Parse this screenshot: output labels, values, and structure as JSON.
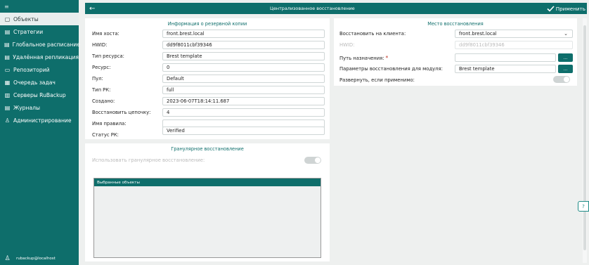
{
  "sidebar": {
    "menu_glyph": "≡",
    "items": [
      {
        "label": "Объекты",
        "icon": "window-icon",
        "active": true
      },
      {
        "label": "Стратегии",
        "icon": "calendar-icon"
      },
      {
        "label": "Глобальное расписание",
        "icon": "calendar-icon"
      },
      {
        "label": "Удалённая репликация",
        "icon": "calendar-icon"
      },
      {
        "label": "Репозиторий",
        "icon": "monitor-icon"
      },
      {
        "label": "Очередь задач",
        "icon": "list-icon"
      },
      {
        "label": "Серверы RuBackup",
        "icon": "server-icon"
      },
      {
        "label": "Журналы",
        "icon": "log-icon"
      },
      {
        "label": "Администрирование",
        "icon": "user-icon"
      }
    ],
    "user": "rubackup@localhost"
  },
  "topbar": {
    "title": "Централизованное восстановление",
    "apply": "Применить"
  },
  "backup_info": {
    "title": "Информация о резервной копии",
    "fields": [
      {
        "label": "Имя хоста:",
        "value": "front.brest.local"
      },
      {
        "label": "HWID:",
        "value": "dd9f8011cbf39346"
      },
      {
        "label": "Тип ресурса:",
        "value": "Brest template"
      },
      {
        "label": "Ресурс:",
        "value": "0"
      },
      {
        "label": "Пул:",
        "value": "Default"
      },
      {
        "label": "Тип РК:",
        "value": "full"
      },
      {
        "label": "Создано:",
        "value": "2023-06-07T18:14:11.687"
      },
      {
        "label": "Восстановить цепочку:",
        "value": "4"
      },
      {
        "label": "Имя правила:",
        "value": ""
      },
      {
        "label": "Статус РК:",
        "value": "Verified"
      }
    ]
  },
  "restore_place": {
    "title": "Место восстановления",
    "client_label": "Восстановить на клиента:",
    "client_value": "front.brest.local",
    "hwid_label": "HWID:",
    "hwid_value": "dd9f8011cbf39346",
    "dest_label": "Путь назначения:",
    "dest_required": "*",
    "dest_value": "",
    "module_label": "Параметры восстановления для модуля:",
    "module_value": "Brest template",
    "expand_label": "Развернуть, если применимо:",
    "browse_label": "...",
    "expand_on": false
  },
  "granular": {
    "title": "Гранулярное восстановление",
    "use_label": "Использовать гранулярное восстановление:",
    "use_on": false,
    "selected_header": "Выбранные объекты"
  },
  "help_glyph": "?",
  "colors": {
    "accent": "#0e6e6b",
    "required": "#c0392b"
  }
}
